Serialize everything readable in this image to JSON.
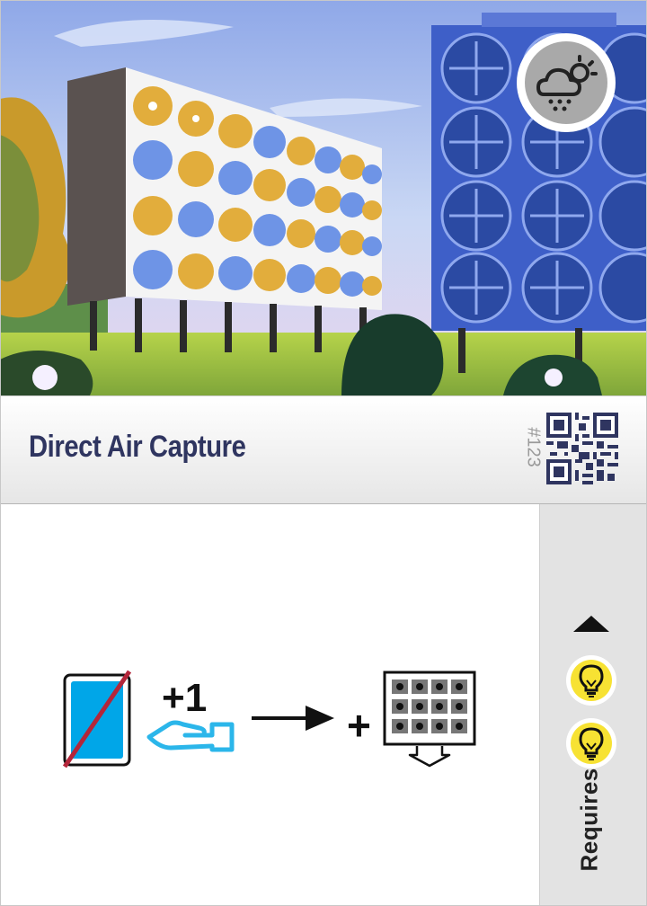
{
  "card": {
    "title": "Direct Air Capture",
    "number": "#123",
    "requires_label": "Requires"
  },
  "effect": {
    "gain_amount": "+1",
    "plus": "+"
  },
  "icons": {
    "category_badge": "weather-cloud-sun-icon",
    "discard_card": "crossed-out-card-icon",
    "gain": "open-hand-icon",
    "arrow": "arrow-right-icon",
    "result_tile": "fan-array-tile-icon",
    "requirements": [
      "up-triangle-icon",
      "lightbulb-icon",
      "lightbulb-icon"
    ]
  },
  "colors": {
    "title": "#2f3560",
    "card_blue": "#00a6e8",
    "hand_blue": "#2bb6ea",
    "strike_red": "#b3263a",
    "bulb_yellow": "#f7e233",
    "sidebar": "#e3e3e3"
  }
}
